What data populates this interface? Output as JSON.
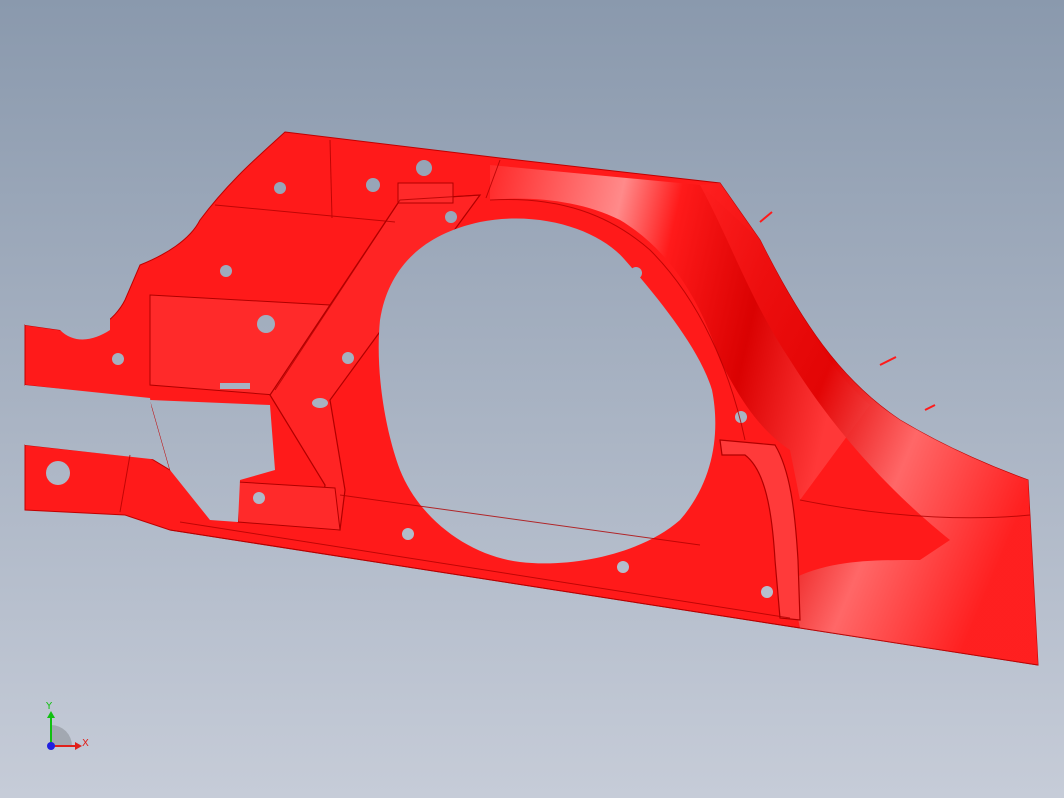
{
  "viewport": {
    "background_top": "#8a99ad",
    "background_bottom": "#c6ccd8"
  },
  "part": {
    "color": "#ff1a1a",
    "shade": "#e00000",
    "highlight": "#ffb0b0",
    "edge": "#b00000"
  },
  "triad": {
    "x_label": "X",
    "y_label": "Y",
    "x_color": "#e0201a",
    "y_color": "#10c010",
    "z_color": "#2020e0"
  }
}
